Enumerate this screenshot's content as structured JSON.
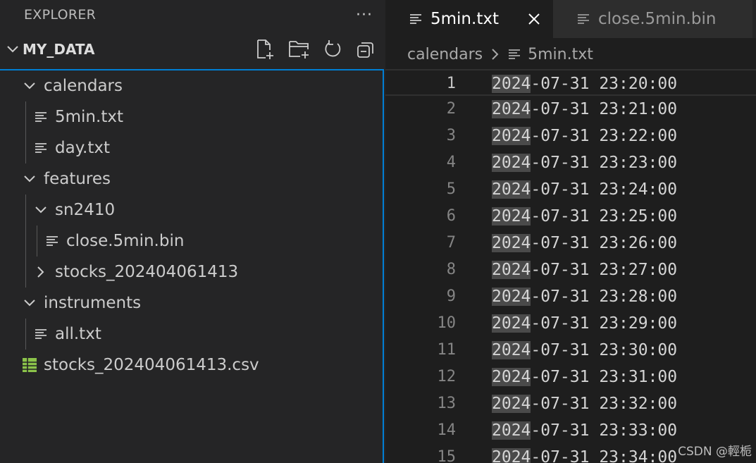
{
  "explorer": {
    "title": "EXPLORER",
    "more_label": "···",
    "section_title": "MY_DATA"
  },
  "tree": [
    {
      "label": "calendars",
      "kind": "folder-open",
      "depth": 0
    },
    {
      "label": "5min.txt",
      "kind": "file",
      "depth": 1
    },
    {
      "label": "day.txt",
      "kind": "file",
      "depth": 1
    },
    {
      "label": "features",
      "kind": "folder-open",
      "depth": 0
    },
    {
      "label": "sn2410",
      "kind": "folder-open",
      "depth": 1
    },
    {
      "label": "close.5min.bin",
      "kind": "file",
      "depth": 2
    },
    {
      "label": "stocks_202404061413",
      "kind": "folder-closed",
      "depth": 1
    },
    {
      "label": "instruments",
      "kind": "folder-open",
      "depth": 0
    },
    {
      "label": "all.txt",
      "kind": "file",
      "depth": 1
    },
    {
      "label": "stocks_202404061413.csv",
      "kind": "csv",
      "depth": 0
    }
  ],
  "tabs": [
    {
      "label": "5min.txt",
      "active": true
    },
    {
      "label": "close.5min.bin",
      "active": false
    }
  ],
  "breadcrumb": {
    "folder": "calendars",
    "file": "5min.txt"
  },
  "editor": {
    "current_line": 1,
    "lines": [
      {
        "n": "1",
        "year": "2024",
        "rest": "-07-31 23:20:00"
      },
      {
        "n": "2",
        "year": "2024",
        "rest": "-07-31 23:21:00"
      },
      {
        "n": "3",
        "year": "2024",
        "rest": "-07-31 23:22:00"
      },
      {
        "n": "4",
        "year": "2024",
        "rest": "-07-31 23:23:00"
      },
      {
        "n": "5",
        "year": "2024",
        "rest": "-07-31 23:24:00"
      },
      {
        "n": "6",
        "year": "2024",
        "rest": "-07-31 23:25:00"
      },
      {
        "n": "7",
        "year": "2024",
        "rest": "-07-31 23:26:00"
      },
      {
        "n": "8",
        "year": "2024",
        "rest": "-07-31 23:27:00"
      },
      {
        "n": "9",
        "year": "2024",
        "rest": "-07-31 23:28:00"
      },
      {
        "n": "10",
        "year": "2024",
        "rest": "-07-31 23:29:00"
      },
      {
        "n": "11",
        "year": "2024",
        "rest": "-07-31 23:30:00"
      },
      {
        "n": "12",
        "year": "2024",
        "rest": "-07-31 23:31:00"
      },
      {
        "n": "13",
        "year": "2024",
        "rest": "-07-31 23:32:00"
      },
      {
        "n": "14",
        "year": "2024",
        "rest": "-07-31 23:33:00"
      },
      {
        "n": "15",
        "year": "2024",
        "rest": "-07-31 23:34:00"
      }
    ]
  },
  "watermark": "CSDN @輕栀",
  "colors": {
    "focus_border": "#007fd4",
    "csv_icon": "#8bc34a",
    "selection_highlight": "#4a4a4a"
  }
}
